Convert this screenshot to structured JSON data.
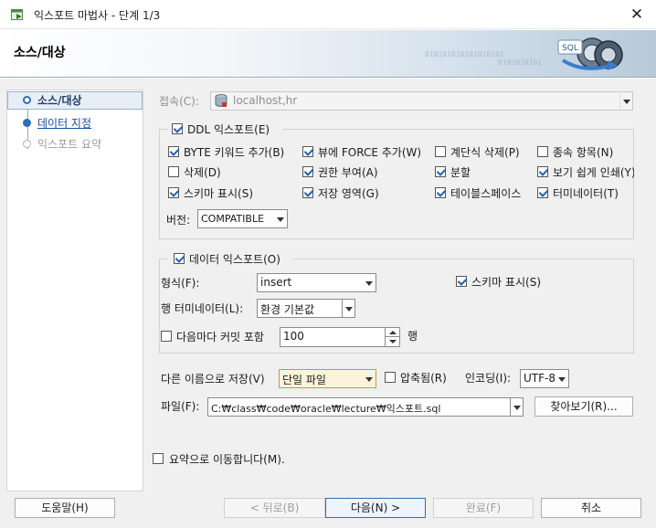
{
  "window": {
    "title": "익스포트 마법사 - 단계 1/3",
    "close_glyph": "✕"
  },
  "banner": {
    "title": "소스/대상",
    "binary_line1": "010101010101010101",
    "binary_line2": "0101010101",
    "art_label": "SQL"
  },
  "nav": {
    "items": [
      {
        "label": "소스/대상",
        "state": "current"
      },
      {
        "label": "데이터 지정",
        "state": "link"
      },
      {
        "label": "익스포트 요약",
        "state": "disabled"
      }
    ]
  },
  "connection": {
    "label": "접속(C):",
    "value": "localhost,hr"
  },
  "ddl": {
    "label": "DDL 익스포트(E)",
    "checked": true,
    "options": [
      {
        "label": "BYTE 키워드 추가(B)",
        "checked": true
      },
      {
        "label": "뷰에 FORCE 추가(W)",
        "checked": true
      },
      {
        "label": "계단식 삭제(P)",
        "checked": false
      },
      {
        "label": "종속 항목(N)",
        "checked": false
      },
      {
        "label": "삭제(D)",
        "checked": false
      },
      {
        "label": "권한 부여(A)",
        "checked": true
      },
      {
        "label": "분할",
        "checked": true
      },
      {
        "label": "보기 쉽게 인쇄(Y)",
        "checked": true
      },
      {
        "label": "스키마 표시(S)",
        "checked": true
      },
      {
        "label": "저장 영역(G)",
        "checked": true
      },
      {
        "label": "테이블스페이스",
        "checked": true
      },
      {
        "label": "터미네이터(T)",
        "checked": true
      }
    ],
    "version_label": "버전:",
    "version_value": "COMPATIBLE"
  },
  "data_export": {
    "label": "데이터 익스포트(O)",
    "checked": true,
    "format_label": "형식(F):",
    "format_value": "insert",
    "show_schema_label": "스키마 표시(S)",
    "show_schema_checked": true,
    "terminator_label": "행 터미네이터(L):",
    "terminator_value": "환경 기본값",
    "commit_label": "다음마다 커밋 포함",
    "commit_checked": false,
    "commit_value": "100",
    "commit_unit": "행"
  },
  "save": {
    "save_as_label": "다른 이름으로 저장(V)",
    "save_as_value": "단일 파일",
    "compress_label": "압축됨(R)",
    "compress_checked": false,
    "encoding_label": "인코딩(I):",
    "encoding_value": "UTF-8",
    "file_label": "파일(F):",
    "file_value": "C:₩class₩code₩oracle₩lecture₩익스포트.sql",
    "browse_label": "찾아보기(R)..."
  },
  "summary_jump": {
    "label": "요약으로 이동합니다(M).",
    "checked": false
  },
  "footer": {
    "help": "도움말(H)",
    "back": "< 뒤로(B)",
    "next": "다음(N) >",
    "finish": "완료(F)",
    "cancel": "취소"
  }
}
